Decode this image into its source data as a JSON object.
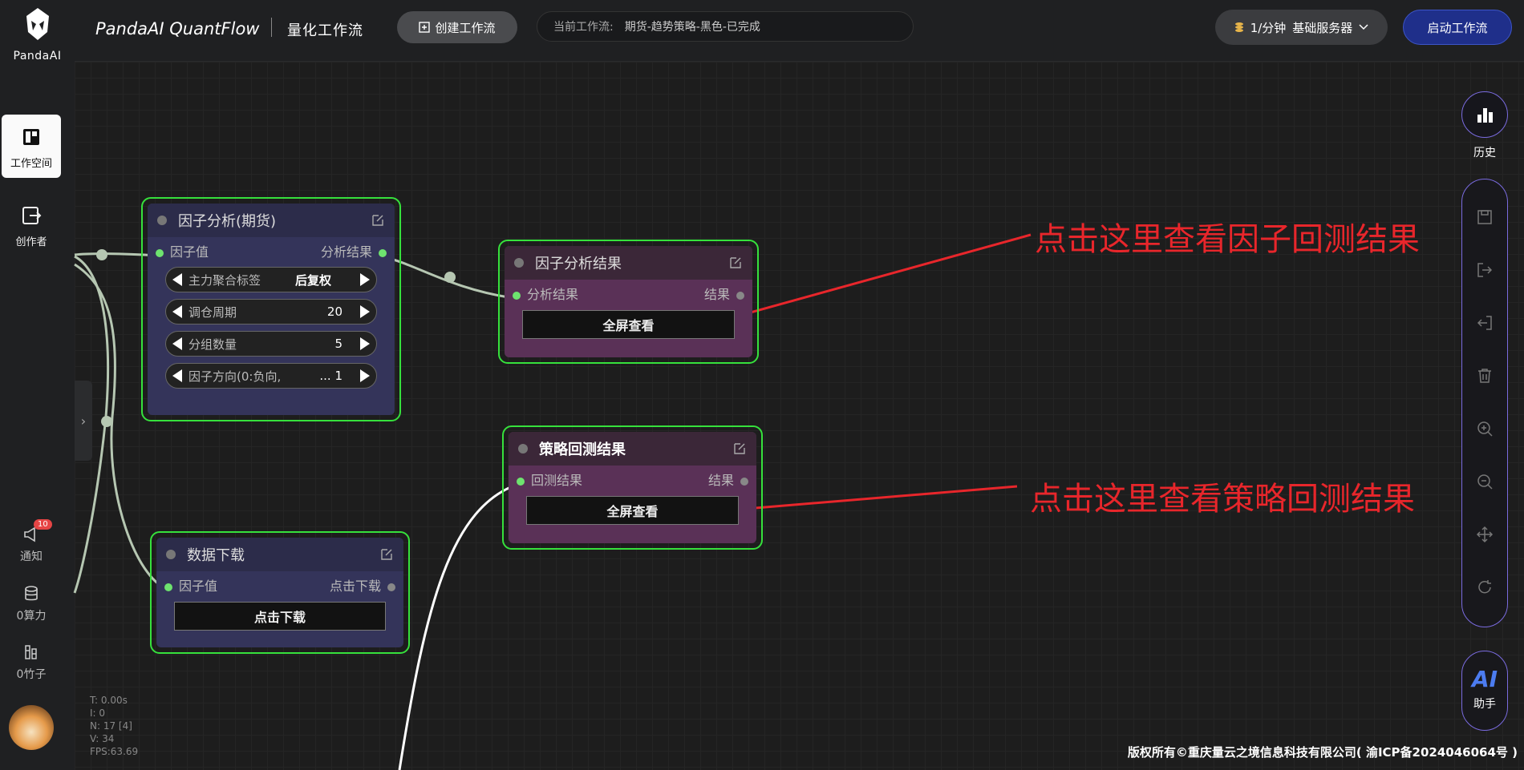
{
  "brand": {
    "logo_text": "PandaAI",
    "title": "PandaAI QuantFlow",
    "title_cn": "量化工作流"
  },
  "topbar": {
    "create_label": "创建工作流",
    "current_label": "当前工作流:",
    "current_value": "期货-趋势策略-黑色-已完成",
    "server_rate": "1/分钟",
    "server_name": "基础服务器",
    "start_label": "启动工作流"
  },
  "leftnav": {
    "workspace": "工作空间",
    "creator": "创作者",
    "notice": "通知",
    "notice_count": "10",
    "compute": "0算力",
    "bamboo": "0竹子"
  },
  "nodes": {
    "factor": {
      "title": "因子分析(期货)",
      "in_port": "因子值",
      "out_port": "分析结果",
      "params": [
        {
          "label": "主力聚合标签",
          "value": "后复权"
        },
        {
          "label": "调仓周期",
          "value": "20"
        },
        {
          "label": "分组数量",
          "value": "5"
        },
        {
          "label": "因子方向(0:负向,",
          "value": "... 1"
        }
      ]
    },
    "factor_result": {
      "title": "因子分析结果",
      "in_port": "分析结果",
      "out_port": "结果",
      "button": "全屏查看"
    },
    "strategy_result": {
      "title": "策略回测结果",
      "in_port": "回测结果",
      "out_port": "结果",
      "button": "全屏查看"
    },
    "download": {
      "title": "数据下载",
      "in_port": "因子值",
      "out_port": "点击下载",
      "button": "点击下载"
    }
  },
  "annotations": {
    "factor_hint": "点击这里查看因子回测结果",
    "strategy_hint": "点击这里查看策略回测结果",
    "color": "#e8262b"
  },
  "righttools": {
    "history": "历史",
    "ai_logo": "AI",
    "ai_label": "助手"
  },
  "stats": {
    "t": "T: 0.00s",
    "i": "I: 0",
    "n": "N: 17 [4]",
    "v": "V: 34",
    "fps": "FPS:63.69"
  },
  "footer": "版权所有©重庆量云之境信息科技有限公司( 渝ICP备2024046064号 )",
  "colors": {
    "node_border": "#36e13c",
    "accent": "#1f2f8a",
    "toolbar_border": "#7a6be0"
  }
}
